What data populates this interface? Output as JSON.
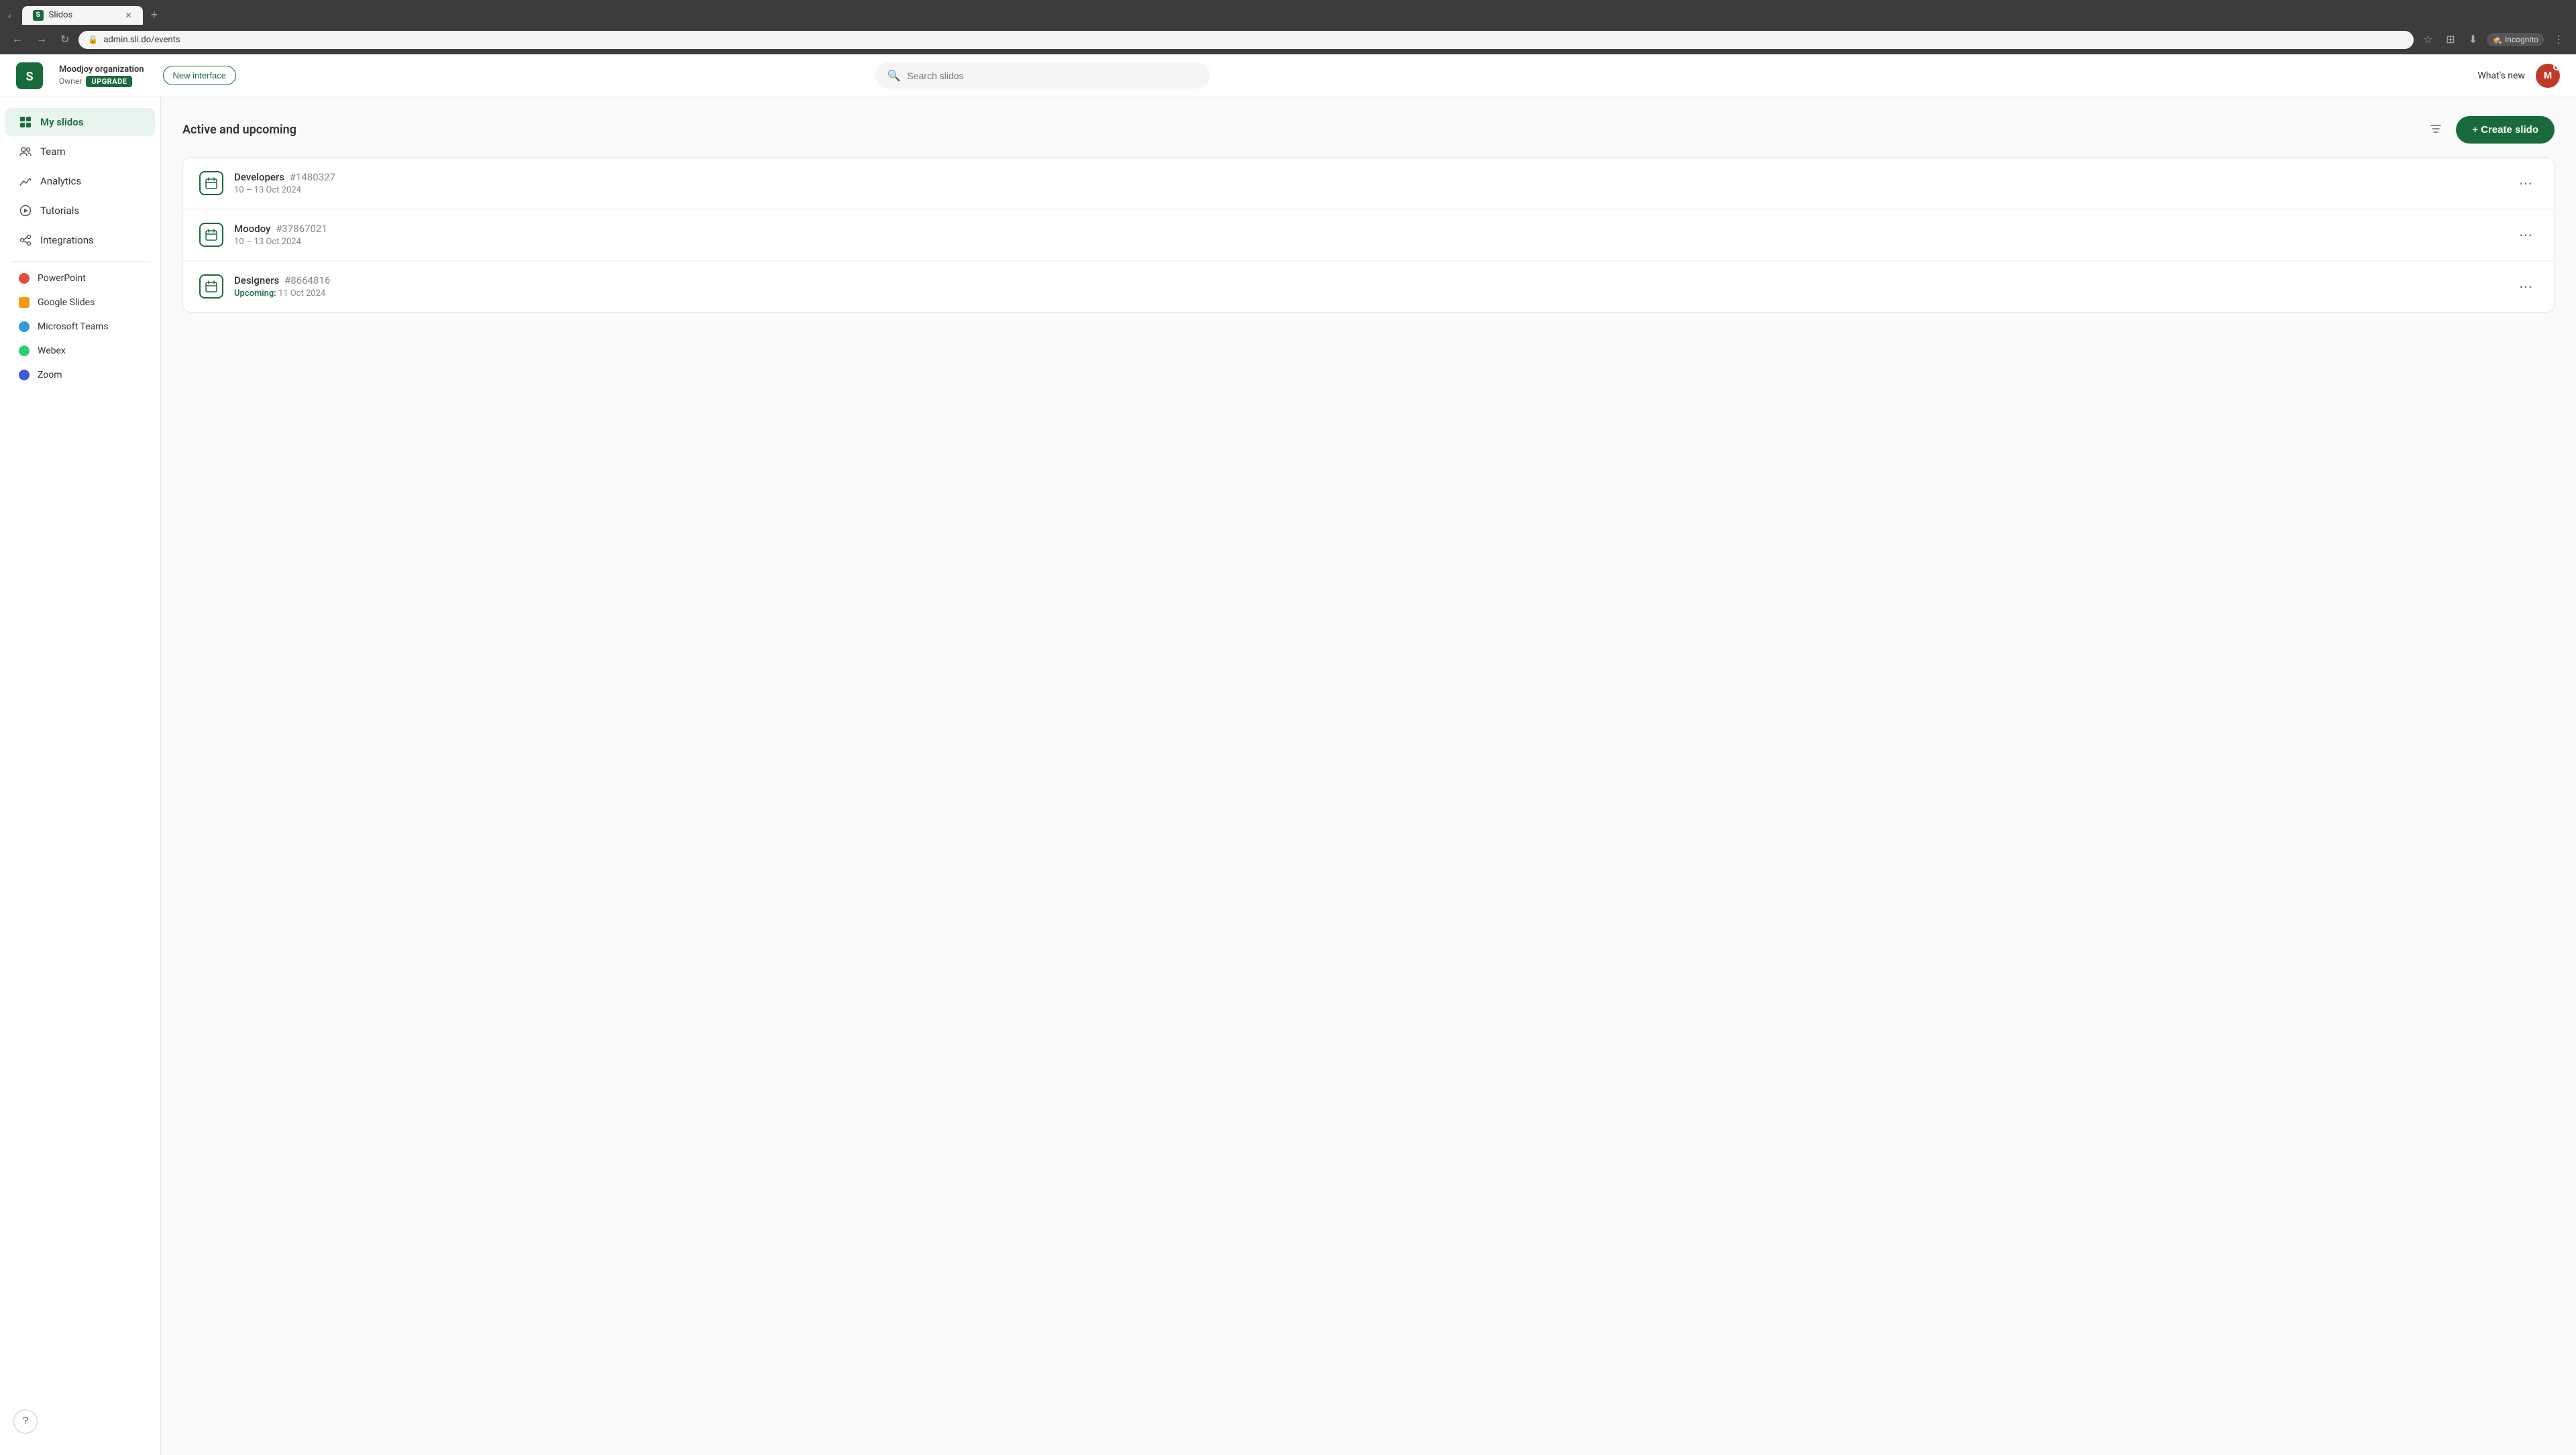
{
  "browser": {
    "tab_favicon": "S",
    "tab_title": "Slidos",
    "url": "admin.sli.do/events",
    "incognito_label": "Incognito"
  },
  "header": {
    "org_name": "Moodjoy organization",
    "org_role": "Owner",
    "upgrade_label": "UPGRADE",
    "new_interface_label": "New interface",
    "search_placeholder": "Search slidos",
    "whats_new_label": "What's new",
    "avatar_initials": "M"
  },
  "sidebar": {
    "items": [
      {
        "label": "My slidos",
        "icon": "grid-icon",
        "active": true
      },
      {
        "label": "Team",
        "icon": "team-icon",
        "active": false
      },
      {
        "label": "Analytics",
        "icon": "analytics-icon",
        "active": false
      },
      {
        "label": "Tutorials",
        "icon": "tutorials-icon",
        "active": false
      },
      {
        "label": "Integrations",
        "icon": "integrations-icon",
        "active": false
      }
    ],
    "integrations": [
      {
        "label": "PowerPoint",
        "color": "#e74c3c"
      },
      {
        "label": "Google Slides",
        "color": "#f39c12"
      },
      {
        "label": "Microsoft Teams",
        "color": "#3498db"
      },
      {
        "label": "Webex",
        "color": "#2ecc71"
      },
      {
        "label": "Zoom",
        "color": "#3b5bdb"
      }
    ],
    "help_label": "?"
  },
  "content": {
    "section_title": "Active and upcoming",
    "create_button_label": "+ Create slido",
    "events": [
      {
        "name": "Developers",
        "id": "#1480327",
        "date": "10 – 13 Oct 2024",
        "upcoming": false
      },
      {
        "name": "Moodoy",
        "id": "#37867021",
        "date": "10 – 13 Oct 2024",
        "upcoming": false
      },
      {
        "name": "Designers",
        "id": "#8664816",
        "date": "11 Oct 2024",
        "upcoming": true,
        "upcoming_label": "Upcoming:"
      }
    ]
  }
}
